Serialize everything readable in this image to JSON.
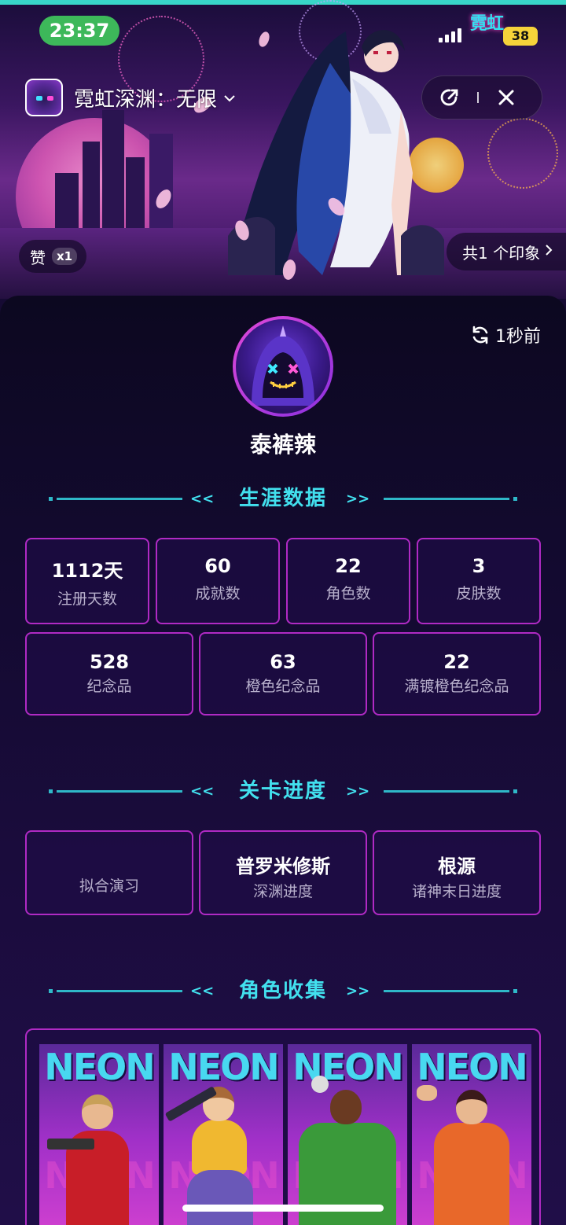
{
  "status_bar": {
    "time": "23:37",
    "battery": "38",
    "logo_text": "霓虹"
  },
  "header": {
    "game_title": "霓虹深渊：无限"
  },
  "hero": {
    "like_label": "赞",
    "like_count": "x1",
    "impressions_label": "共1 个印象"
  },
  "profile": {
    "refresh_label": "1秒前",
    "username": "泰裤辣"
  },
  "career": {
    "title": "生涯数据",
    "stats_row1": [
      {
        "value": "1112天",
        "label": "注册天数"
      },
      {
        "value": "60",
        "label": "成就数"
      },
      {
        "value": "22",
        "label": "角色数"
      },
      {
        "value": "3",
        "label": "皮肤数"
      }
    ],
    "stats_row2": [
      {
        "value": "528",
        "label": "纪念品"
      },
      {
        "value": "63",
        "label": "橙色纪念品"
      },
      {
        "value": "22",
        "label": "满镀橙色纪念品"
      }
    ]
  },
  "progress": {
    "title": "关卡进度",
    "items": [
      {
        "value": "",
        "label": "拟合演习"
      },
      {
        "value": "普罗米修斯",
        "label": "深渊进度"
      },
      {
        "value": "根源",
        "label": "诸神末日进度"
      }
    ]
  },
  "collection": {
    "title": "角色收集",
    "cards": [
      {
        "banner": "NEON"
      },
      {
        "banner": "NEON"
      },
      {
        "banner": "NEON"
      },
      {
        "banner": "NEON"
      }
    ]
  },
  "colors": {
    "accent_cyan": "#42e0ee",
    "card_border": "#b02ac4",
    "time_pill": "#3db85a",
    "battery": "#f6d33a"
  }
}
